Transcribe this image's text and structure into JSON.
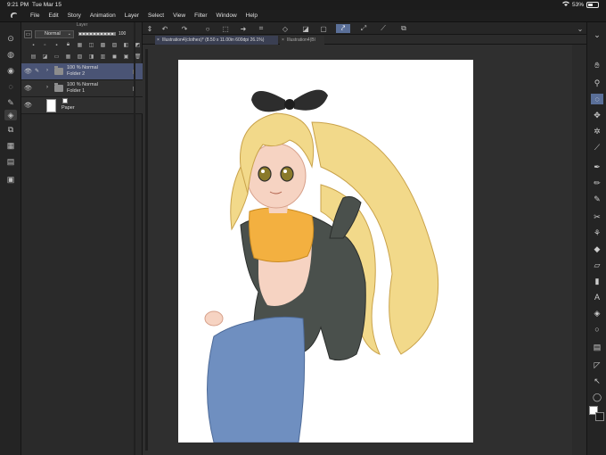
{
  "status": {
    "time": "9:21 PM",
    "date": "Tue Mar 15",
    "battery": "53%",
    "battery_level": 0.53
  },
  "menu": [
    "File",
    "Edit",
    "Story",
    "Animation",
    "Layer",
    "Select",
    "View",
    "Filter",
    "Window",
    "Help"
  ],
  "layer_panel": {
    "title": "Layer",
    "blend_mode": "Normal",
    "opacity": "100",
    "opacity_level": 1.0,
    "layers": [
      {
        "percent": "100 %",
        "mode": "Normal",
        "name": "Folder 2",
        "selected": true
      },
      {
        "percent": "100 %",
        "mode": "Normal",
        "name": "Folder 1",
        "selected": false
      }
    ],
    "paper": {
      "name": "Paper"
    }
  },
  "tabs": {
    "active": "Illustration4(clothes)* (8.50 x 11.00in 600dpi 26.1%)",
    "inactive": "Illustration4(Bl"
  },
  "colors": {
    "accent": "#5a6f98",
    "selected_layer": "#4a5475",
    "panel": "#2a2a2a",
    "paper": "#ffffff",
    "hair": "#f2d98a",
    "top": "#f3b040",
    "jeans": "#6f8fc0",
    "jacket": "#4a504c",
    "bow": "#2d2d2d"
  }
}
